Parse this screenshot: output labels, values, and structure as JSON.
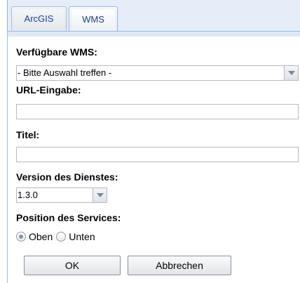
{
  "tabs": [
    {
      "label": "ArcGIS",
      "active": false
    },
    {
      "label": "WMS",
      "active": true
    }
  ],
  "form": {
    "available_wms": {
      "label": "Verfügbare WMS:",
      "selected": "- Bitte Auswahl treffen -"
    },
    "url": {
      "label": "URL-Eingabe:",
      "value": ""
    },
    "title": {
      "label": "Titel:",
      "value": ""
    },
    "version": {
      "label": "Version des Dienstes:",
      "selected": "1.3.0"
    },
    "position": {
      "label": "Position des Services:",
      "options": [
        {
          "label": "Oben",
          "selected": true
        },
        {
          "label": "Unten",
          "selected": false
        }
      ]
    }
  },
  "buttons": {
    "ok": "OK",
    "cancel": "Abbrechen"
  }
}
